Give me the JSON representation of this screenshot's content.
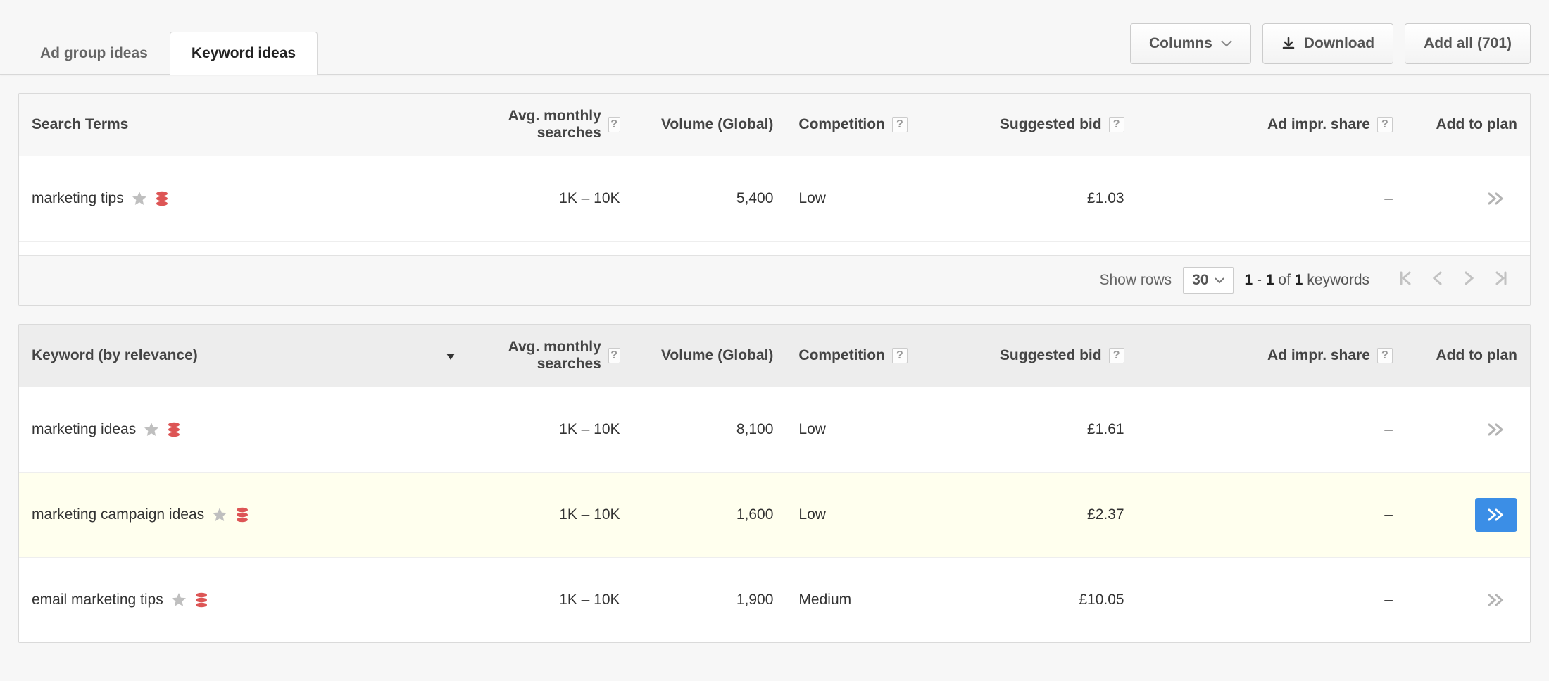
{
  "topbar": {
    "tabs": [
      {
        "label": "Ad group ideas",
        "active": false
      },
      {
        "label": "Keyword ideas",
        "active": true
      }
    ],
    "columns_btn": "Columns",
    "download_btn": "Download",
    "add_all_btn": "Add all (701)"
  },
  "columns": {
    "search_terms": "Search Terms",
    "keyword_by_relevance": "Keyword (by relevance)",
    "avg_monthly": "Avg. monthly searches",
    "volume_global": "Volume (Global)",
    "competition": "Competition",
    "suggested_bid": "Suggested bid",
    "ad_impr_share": "Ad impr. share",
    "add_to_plan": "Add to plan"
  },
  "search_terms_rows": [
    {
      "term": "marketing tips",
      "avg": "1K – 10K",
      "volume": "5,400",
      "competition": "Low",
      "bid": "£1.03",
      "share": "–"
    }
  ],
  "pager": {
    "show_rows_label": "Show rows",
    "rows_value": "30",
    "range_from": "1",
    "range_to": "1",
    "of_word": "of",
    "total": "1",
    "unit": "keywords"
  },
  "keyword_rows": [
    {
      "term": "marketing ideas",
      "avg": "1K – 10K",
      "volume": "8,100",
      "competition": "Low",
      "bid": "£1.61",
      "share": "–",
      "highlight": false,
      "primary_add": false
    },
    {
      "term": "marketing campaign ideas",
      "avg": "1K – 10K",
      "volume": "1,600",
      "competition": "Low",
      "bid": "£2.37",
      "share": "–",
      "highlight": true,
      "primary_add": true
    },
    {
      "term": "email marketing tips",
      "avg": "1K – 10K",
      "volume": "1,900",
      "competition": "Medium",
      "bid": "£10.05",
      "share": "–",
      "highlight": false,
      "primary_add": false
    }
  ]
}
